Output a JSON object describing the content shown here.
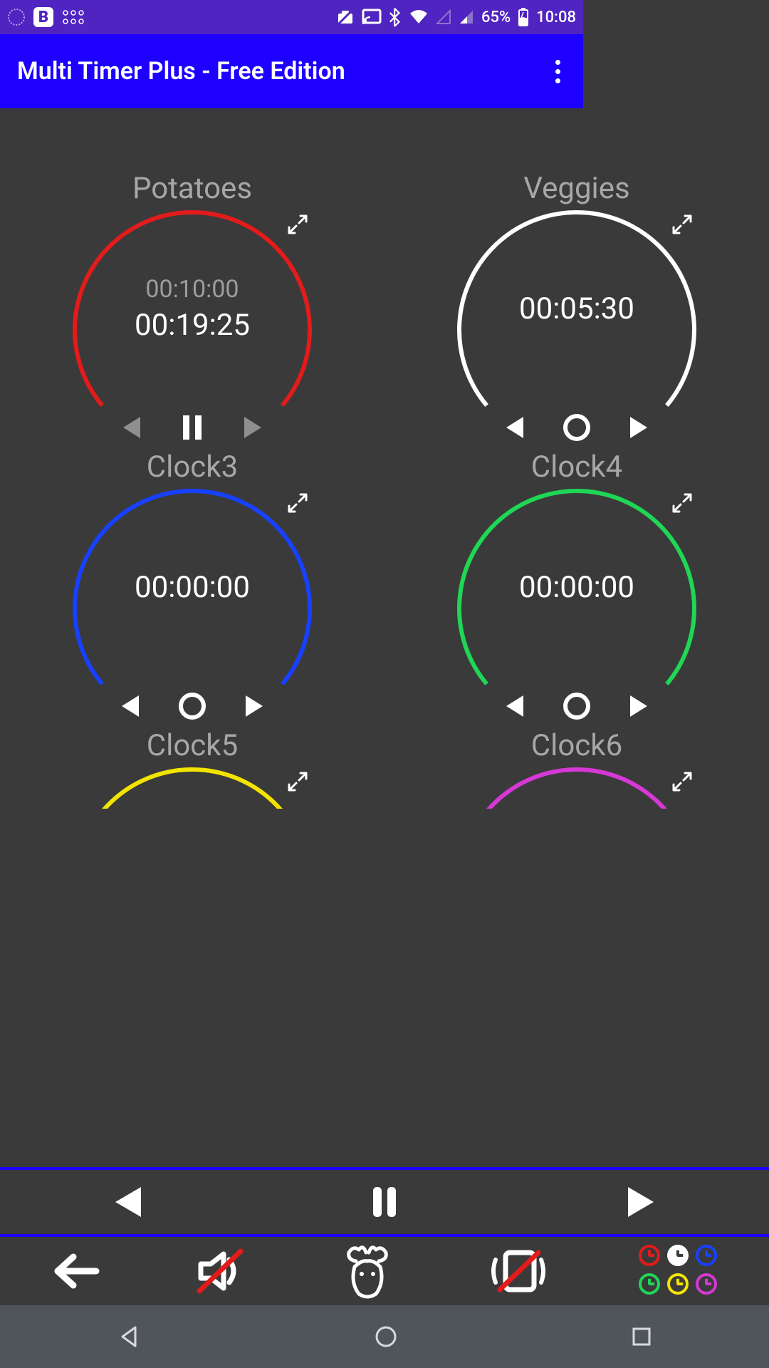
{
  "status": {
    "battery": "65%",
    "time": "10:08"
  },
  "app": {
    "title": "Multi Timer Plus - Free Edition"
  },
  "timers": [
    {
      "name": "Potatoes",
      "sub": "00:10:00",
      "main": "00:19:25",
      "color": "#e31b1b",
      "controls_dim": true
    },
    {
      "name": "Veggies",
      "sub": "",
      "main": "00:05:30",
      "color": "#ffffff",
      "controls_dim": false
    },
    {
      "name": "Clock3",
      "sub": "",
      "main": "00:00:00",
      "color": "#1840ff",
      "controls_dim": false
    },
    {
      "name": "Clock4",
      "sub": "",
      "main": "00:00:00",
      "color": "#1fd655",
      "controls_dim": false
    },
    {
      "name": "Clock5",
      "sub": "",
      "main": "",
      "color": "#f2e400",
      "controls_dim": false,
      "partial": true
    },
    {
      "name": "Clock6",
      "sub": "",
      "main": "",
      "color": "#d638d6",
      "controls_dim": false,
      "partial": true
    }
  ],
  "theme_colors": [
    "#e31b1b",
    "#ffffff",
    "#1840ff",
    "#1fd655",
    "#f2e400",
    "#d638d6"
  ],
  "icons": {
    "back": "back-icon",
    "mute": "mute-icon",
    "moose": "moose-icon",
    "vibrate_off": "vibrate-off-icon"
  }
}
